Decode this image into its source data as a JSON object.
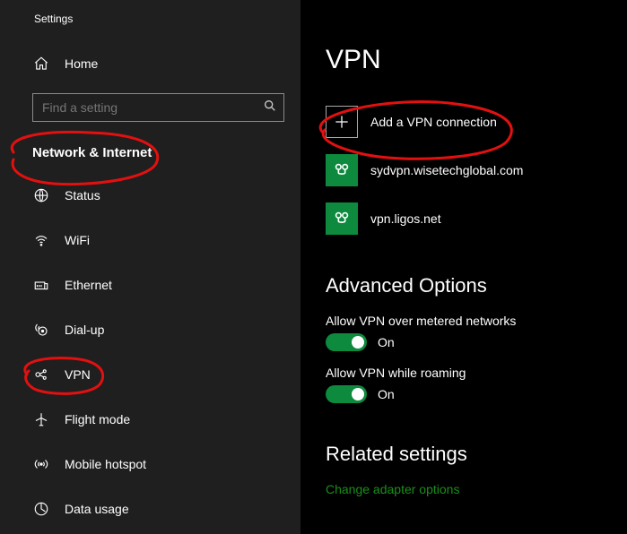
{
  "window": {
    "title": "Settings"
  },
  "sidebar": {
    "home": "Home",
    "search_placeholder": "Find a setting",
    "section": "Network & Internet",
    "items": [
      {
        "label": "Status"
      },
      {
        "label": "WiFi"
      },
      {
        "label": "Ethernet"
      },
      {
        "label": "Dial-up"
      },
      {
        "label": "VPN"
      },
      {
        "label": "Flight mode"
      },
      {
        "label": "Mobile hotspot"
      },
      {
        "label": "Data usage"
      }
    ]
  },
  "main": {
    "heading": "VPN",
    "add_label": "Add a VPN connection",
    "connections": [
      {
        "name": "sydvpn.wisetechglobal.com"
      },
      {
        "name": "vpn.ligos.net"
      }
    ],
    "advanced_heading": "Advanced Options",
    "toggles": [
      {
        "label": "Allow VPN over metered networks",
        "state": "On"
      },
      {
        "label": "Allow VPN while roaming",
        "state": "On"
      }
    ],
    "related_heading": "Related settings",
    "related_link": "Change adapter options"
  }
}
